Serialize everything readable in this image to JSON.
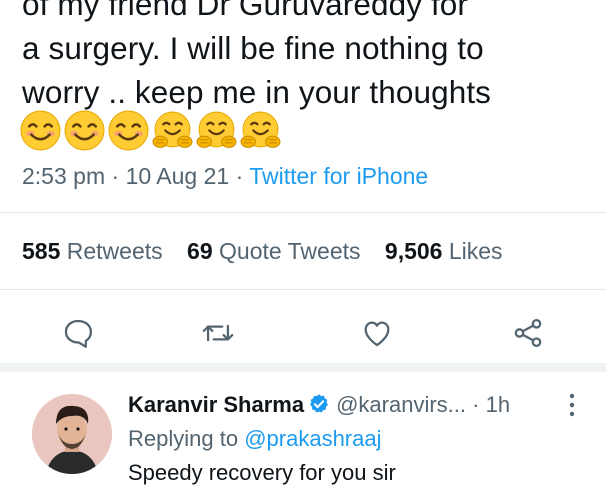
{
  "tweet": {
    "text_lines": [
      "of my friend Dr Guruvareddy for",
      "a surgery. I will be fine nothing to",
      "worry .. keep me in your thoughts"
    ],
    "emojis": [
      "smiling-face-emoji",
      "smiling-face-emoji",
      "smiling-face-emoji",
      "hugging-face-emoji",
      "hugging-face-emoji",
      "hugging-face-emoji"
    ],
    "time": "2:53 pm",
    "separator": "·",
    "date": "10 Aug 21",
    "source": "Twitter for iPhone"
  },
  "stats": {
    "retweets_count": "585",
    "retweets_label": "Retweets",
    "quotes_count": "69",
    "quotes_label": "Quote Tweets",
    "likes_count": "9,506",
    "likes_label": "Likes"
  },
  "actions": [
    "reply-icon",
    "retweet-icon",
    "like-icon",
    "share-icon"
  ],
  "reply": {
    "name": "Karanvir Sharma",
    "handle": "@karanvirs...",
    "separator": "·",
    "time": "1h",
    "replying_prefix": "Replying to",
    "replying_to": "@prakashraaj",
    "text_partial": "Speedy recovery for you sir"
  },
  "colors": {
    "accent": "#1d9bf0",
    "secondary_text": "#536471",
    "primary_text": "#0f1419",
    "divider": "#e3e6e8"
  }
}
